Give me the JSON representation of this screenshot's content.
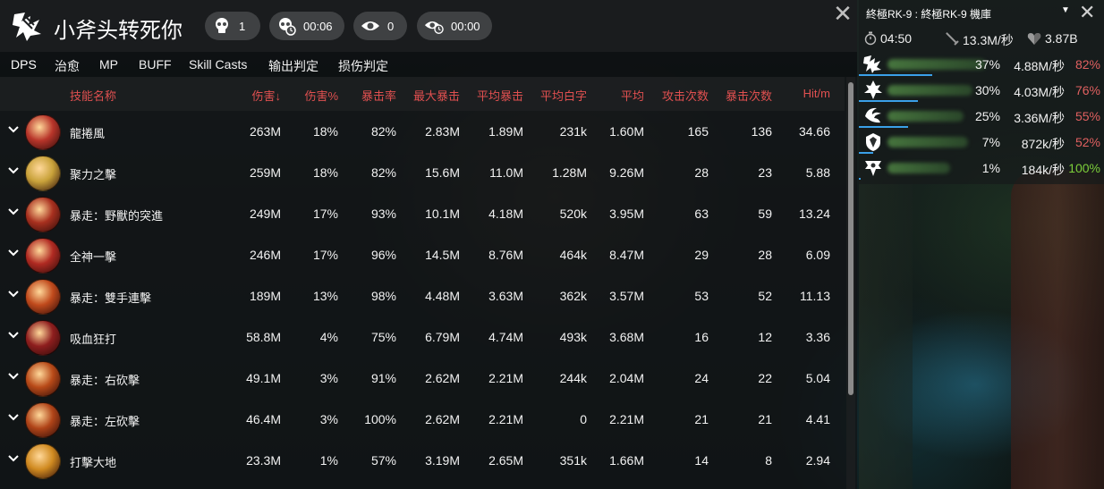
{
  "app": {
    "title": "小斧头转死你"
  },
  "stats": {
    "deaths": "1",
    "death_time": "00:06",
    "eye_count": "0",
    "eye_time": "00:00"
  },
  "tabs": [
    "DPS",
    "治愈",
    "MP",
    "BUFF",
    "Skill Casts",
    "输出判定",
    "损伤判定"
  ],
  "columns": [
    "技能名称",
    "伤害↓",
    "伤害%",
    "暴击率",
    "最大暴击",
    "平均暴击",
    "平均白字",
    "平均",
    "攻击次数",
    "暴击次数",
    "Hit/m"
  ],
  "rows": [
    {
      "name": "龍捲風",
      "icon_color": "#b8352a",
      "vals": [
        "263M",
        "18%",
        "82%",
        "2.83M",
        "1.89M",
        "231k",
        "1.60M",
        "165",
        "136",
        "34.66"
      ]
    },
    {
      "name": "聚力之擊",
      "icon_color": "#c9a23a",
      "vals": [
        "259M",
        "18%",
        "82%",
        "15.6M",
        "11.0M",
        "1.28M",
        "9.26M",
        "28",
        "23",
        "5.88"
      ]
    },
    {
      "name": "暴走：野獸的突進",
      "icon_color": "#a8301f",
      "vals": [
        "249M",
        "17%",
        "93%",
        "10.1M",
        "4.18M",
        "520k",
        "3.95M",
        "63",
        "59",
        "13.24"
      ]
    },
    {
      "name": "全神一擊",
      "icon_color": "#b02a22",
      "vals": [
        "246M",
        "17%",
        "96%",
        "14.5M",
        "8.76M",
        "464k",
        "8.47M",
        "29",
        "28",
        "6.09"
      ]
    },
    {
      "name": "暴走：雙手連擊",
      "icon_color": "#c04a1c",
      "vals": [
        "189M",
        "13%",
        "98%",
        "4.48M",
        "3.63M",
        "362k",
        "3.57M",
        "53",
        "52",
        "11.13"
      ]
    },
    {
      "name": "吸血狂打",
      "icon_color": "#8e1e1e",
      "vals": [
        "58.8M",
        "4%",
        "75%",
        "6.79M",
        "4.74M",
        "493k",
        "3.68M",
        "16",
        "12",
        "3.36"
      ]
    },
    {
      "name": "暴走：右砍擊",
      "icon_color": "#b84a18",
      "vals": [
        "49.1M",
        "3%",
        "91%",
        "2.62M",
        "2.21M",
        "244k",
        "2.04M",
        "24",
        "22",
        "5.04"
      ]
    },
    {
      "name": "暴走：左砍擊",
      "icon_color": "#b04418",
      "vals": [
        "46.4M",
        "3%",
        "100%",
        "2.62M",
        "2.21M",
        "0",
        "2.21M",
        "21",
        "21",
        "4.41"
      ]
    },
    {
      "name": "打擊大地",
      "icon_color": "#d08a20",
      "vals": [
        "23.3M",
        "1%",
        "57%",
        "3.19M",
        "2.65M",
        "351k",
        "1.66M",
        "14",
        "8",
        "2.94"
      ]
    }
  ],
  "side_panel": {
    "title": "終極RK-9 : 終極RK-9 機庫",
    "time": "04:50",
    "dps": "13.3M/秒",
    "total": "3.87B",
    "players": [
      {
        "pct": "37%",
        "dps": "4.88M/秒",
        "crit": "82%",
        "crit_color": "#e06060",
        "bar_fraction": 0.37
      },
      {
        "pct": "30%",
        "dps": "4.03M/秒",
        "crit": "76%",
        "crit_color": "#e06060",
        "bar_fraction": 0.3
      },
      {
        "pct": "25%",
        "dps": "3.36M/秒",
        "crit": "55%",
        "crit_color": "#e06060",
        "bar_fraction": 0.25
      },
      {
        "pct": "7%",
        "dps": "872k/秒",
        "crit": "52%",
        "crit_color": "#e06060",
        "bar_fraction": 0.07
      },
      {
        "pct": "1%",
        "dps": "184k/秒",
        "crit": "100%",
        "crit_color": "#7ccf3a",
        "bar_fraction": 0.01
      }
    ]
  },
  "colors": {
    "header_red": "#e05050",
    "accent_blue": "#4aa3ff"
  },
  "icons": {
    "logo": "axe-class-icon",
    "deaths": "skull-icon",
    "death_time": "skull-clock-icon",
    "eye": "eye-icon",
    "eye_time": "eye-clock-icon"
  }
}
